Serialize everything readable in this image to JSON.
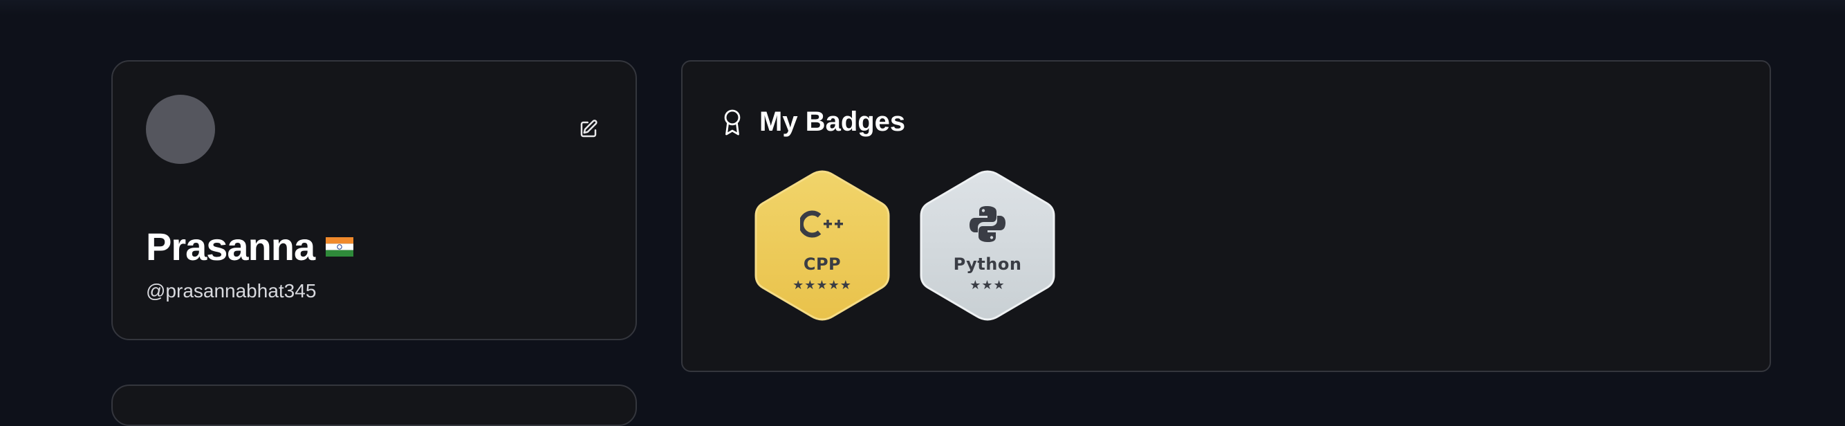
{
  "profile": {
    "name": "Prasanna",
    "username": "@prasannabhat345",
    "country_flag": "india-flag-icon"
  },
  "badges_section": {
    "title": "My Badges",
    "icon": "award-ribbon-icon",
    "badges": [
      {
        "name": "CPP",
        "stars": "★★★★★",
        "star_count": 5,
        "icon": "cpp-logo-icon",
        "color": "#efcb58"
      },
      {
        "name": "Python",
        "stars": "★★★",
        "star_count": 3,
        "icon": "python-logo-icon",
        "color": "#d3d9dd"
      }
    ]
  },
  "colors": {
    "background": "#0e111a",
    "card": "#141519",
    "card_border": "#34363d",
    "gold": "#efcb58",
    "silver": "#d3d9dd"
  }
}
